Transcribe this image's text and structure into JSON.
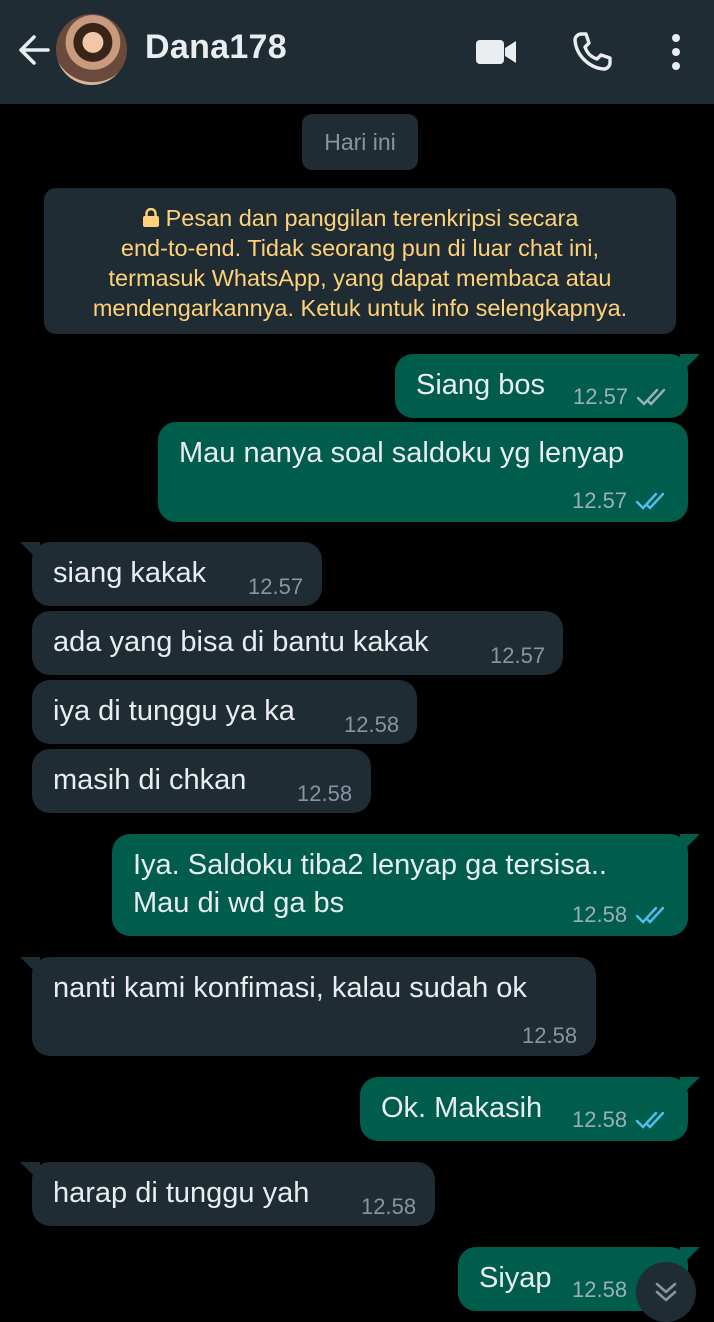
{
  "header": {
    "contact_name": "Dana178",
    "back_icon": "arrow-left-icon",
    "video_icon": "video-camera-icon",
    "call_icon": "phone-icon",
    "more_icon": "more-vertical-icon"
  },
  "date_chip": "Hari ini",
  "encryption_notice": {
    "line1": "Pesan dan panggilan terenkripsi secara",
    "line2": "end-to-end. Tidak seorang pun di luar chat ini,",
    "line3": "termasuk WhatsApp, yang dapat membaca atau",
    "line4": "mendengarkannya. Ketuk untuk info selengkapnya."
  },
  "messages": [
    {
      "dir": "out",
      "text": "Siang bos",
      "time": "12.57",
      "read": false
    },
    {
      "dir": "out",
      "text": "Mau nanya soal saldoku yg lenyap",
      "time": "12.57",
      "read": true
    },
    {
      "dir": "in",
      "text": "siang kakak",
      "time": "12.57"
    },
    {
      "dir": "in",
      "text": "ada yang bisa di bantu kakak",
      "time": "12.57"
    },
    {
      "dir": "in",
      "text": "iya di tunggu ya ka",
      "time": "12.58"
    },
    {
      "dir": "in",
      "text": "masih di chkan",
      "time": "12.58"
    },
    {
      "dir": "out",
      "text": "Iya. Saldoku tiba2 lenyap ga tersisa..",
      "text2": "Mau di wd ga bs",
      "time": "12.58",
      "read": true
    },
    {
      "dir": "in",
      "text": "nanti kami konfimasi, kalau sudah ok",
      "time": "12.58"
    },
    {
      "dir": "out",
      "text": "Ok. Makasih",
      "time": "12.58",
      "read": true
    },
    {
      "dir": "in",
      "text": "harap di tunggu yah",
      "time": "12.58"
    },
    {
      "dir": "out",
      "text": "Siyap",
      "time": "12.58",
      "read": true
    }
  ],
  "colors": {
    "header_bg": "#1f2c33",
    "outgoing_bubble": "#005c4b",
    "incoming_bubble": "#1f2c33",
    "read_tick": "#53bdeb",
    "delivered_tick": "#9bb0b5",
    "notice_text": "#ffd279"
  }
}
